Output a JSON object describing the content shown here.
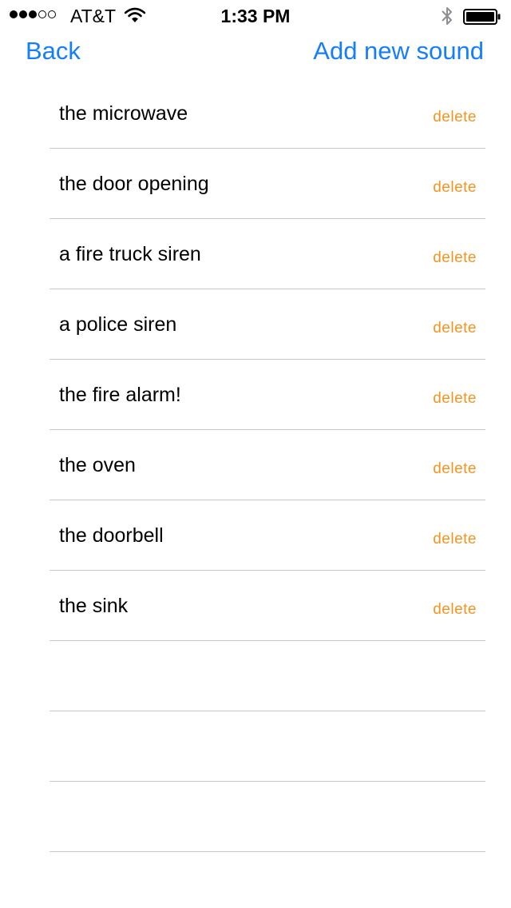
{
  "status_bar": {
    "carrier": "AT&T",
    "time": "1:33 PM",
    "signal_bars_filled": 3,
    "signal_bars_total": 5,
    "icons": [
      "signal-icon",
      "wifi-icon",
      "bluetooth-icon",
      "battery-icon"
    ],
    "battery_level": 1.0
  },
  "nav": {
    "back_label": "Back",
    "add_label": "Add new sound",
    "accent_color": "#157efb"
  },
  "sounds": [
    {
      "label": "the microwave",
      "delete_label": "delete"
    },
    {
      "label": "the door opening",
      "delete_label": "delete"
    },
    {
      "label": "a fire truck siren",
      "delete_label": "delete"
    },
    {
      "label": "a police siren",
      "delete_label": "delete"
    },
    {
      "label": "the fire alarm!",
      "delete_label": "delete"
    },
    {
      "label": "the oven",
      "delete_label": "delete"
    },
    {
      "label": "the doorbell",
      "delete_label": "delete"
    },
    {
      "label": "the sink",
      "delete_label": "delete"
    }
  ],
  "empty_rows": 3,
  "colors": {
    "delete": "#f5931e",
    "separator": "#c8c7cc"
  }
}
